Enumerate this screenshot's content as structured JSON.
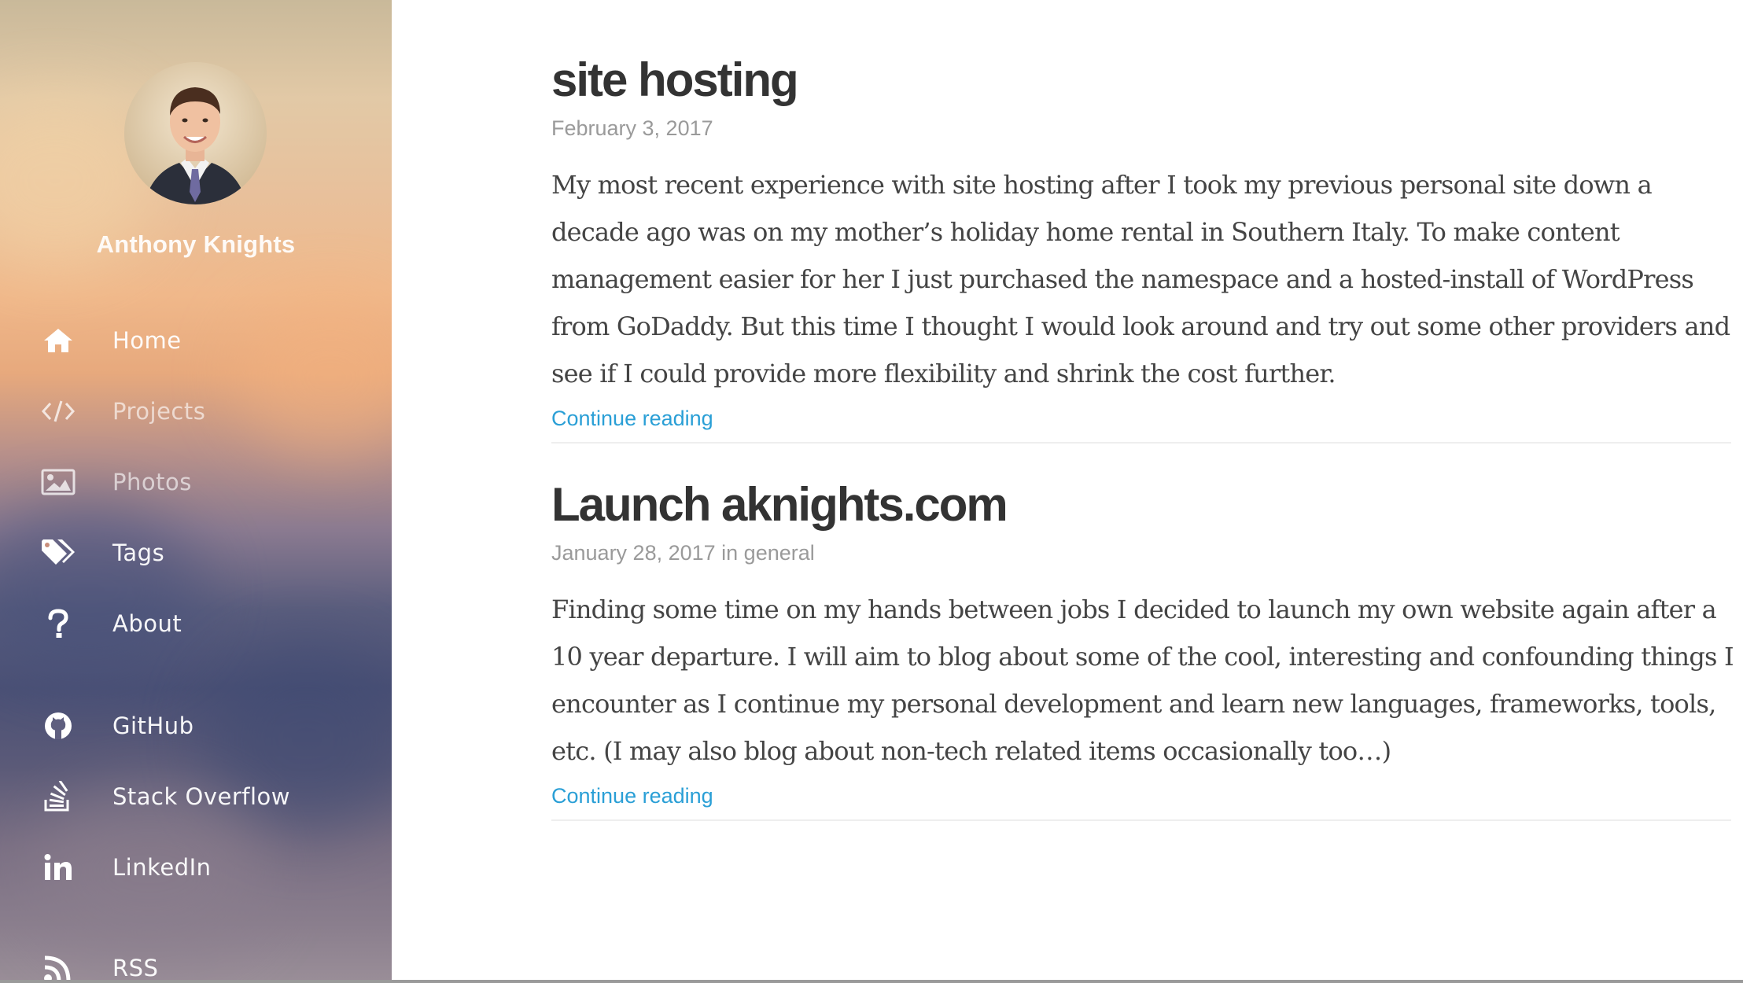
{
  "sidebar": {
    "name": "Anthony Knights",
    "nav": [
      {
        "icon": "home-icon",
        "label": "Home"
      },
      {
        "icon": "code-icon",
        "label": "Projects"
      },
      {
        "icon": "image-icon",
        "label": "Photos"
      },
      {
        "icon": "tags-icon",
        "label": "Tags"
      },
      {
        "icon": "question-icon",
        "label": "About"
      }
    ],
    "social": [
      {
        "icon": "github-icon",
        "label": "GitHub"
      },
      {
        "icon": "stack-overflow-icon",
        "label": "Stack Overflow"
      },
      {
        "icon": "linkedin-icon",
        "label": "LinkedIn"
      },
      {
        "icon": "rss-icon",
        "label": "RSS"
      }
    ]
  },
  "posts": [
    {
      "title": "site hosting",
      "meta": "February 3, 2017",
      "body": "My most recent experience with site hosting after I took my previous personal site down a decade ago was on my mother’s holiday home rental in Southern Italy. To make content management easier for her I just purchased the namespace and a hosted-install of WordPress from GoDaddy. But this time I thought I would look around and try out some other providers and see if I could provide more flexibility and shrink the cost further.",
      "continue": "Continue reading"
    },
    {
      "title": "Launch aknights.com",
      "meta": "January 28, 2017 in general",
      "body": "Finding some time on my hands between jobs I decided to launch my own website again after a 10 year departure. I will aim to blog about some of the cool, interesting and confounding things I encounter as I continue my personal development and learn new languages, frameworks, tools, etc. (I may also blog about non-tech related items occasionally too…)",
      "continue": "Continue reading"
    }
  ],
  "colors": {
    "link": "#2a9fd6",
    "title": "#333333",
    "meta": "#9a9a9a",
    "body": "#444444"
  }
}
